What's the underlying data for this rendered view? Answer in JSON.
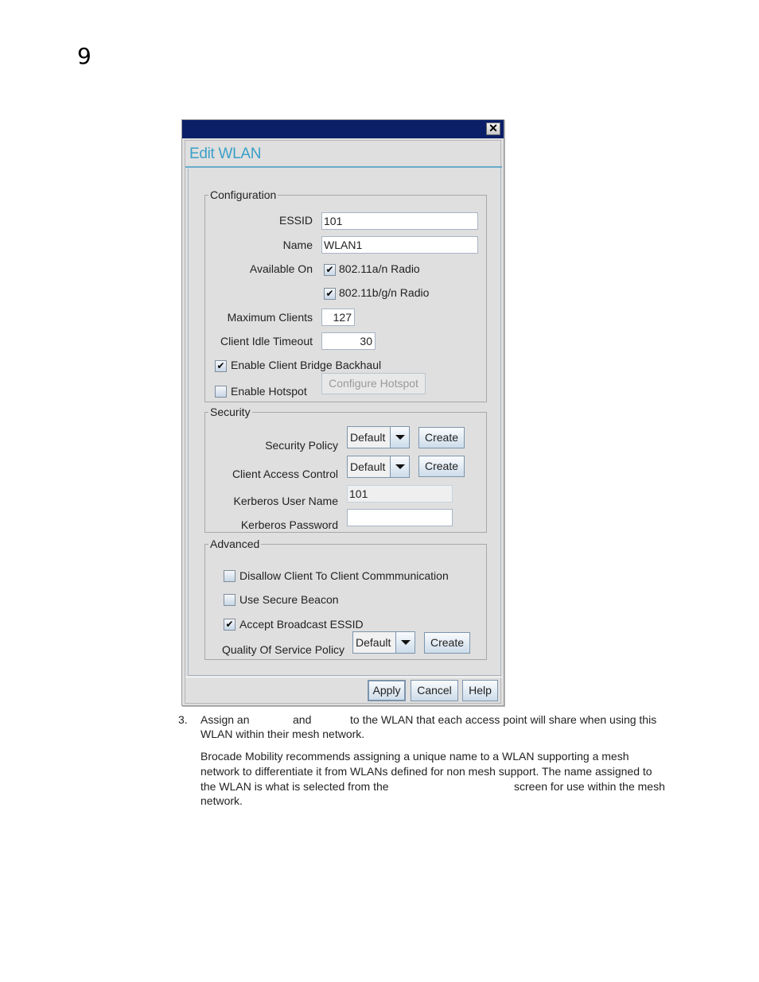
{
  "page": {
    "chapter_number": "9"
  },
  "window": {
    "close_glyph": "✕",
    "dialog_title": "Edit WLAN",
    "configuration": {
      "legend": "Configuration",
      "essid_label": "ESSID",
      "essid_value": "101",
      "name_label": "Name",
      "name_value": "WLAN1",
      "available_on_label": "Available On",
      "radio_an_label": "802.11a/n Radio",
      "radio_an_checked": true,
      "radio_bgn_label": "802.11b/g/n Radio",
      "radio_bgn_checked": true,
      "max_clients_label": "Maximum Clients",
      "max_clients_value": "127",
      "idle_timeout_label": "Client Idle Timeout",
      "idle_timeout_value": "30",
      "bridge_backhaul_label": "Enable Client Bridge Backhaul",
      "bridge_backhaul_checked": true,
      "hotspot_label": "Enable Hotspot",
      "hotspot_checked": false,
      "configure_hotspot_label": "Configure Hotspot"
    },
    "security": {
      "legend": "Security",
      "security_policy_label": "Security Policy",
      "security_policy_value": "Default",
      "client_access_label": "Client Access Control",
      "client_access_value": "Default",
      "create_label": "Create",
      "kerberos_user_label": "Kerberos User Name",
      "kerberos_user_value": "101",
      "kerberos_password_label": "Kerberos Password",
      "kerberos_password_value": ""
    },
    "advanced": {
      "legend": "Advanced",
      "disallow_label": "Disallow Client To Client Commmunication",
      "disallow_checked": false,
      "secure_beacon_label": "Use Secure Beacon",
      "secure_beacon_checked": false,
      "accept_broadcast_label": "Accept Broadcast ESSID",
      "accept_broadcast_checked": true,
      "qos_label": "Quality Of Service Policy",
      "qos_value": "Default",
      "create_label": "Create"
    },
    "footer": {
      "apply": "Apply",
      "cancel": "Cancel",
      "help": "Help"
    },
    "check_glyph": "✔"
  },
  "doc": {
    "step_number": "3.",
    "step_part1": "Assign an",
    "step_part2": "and",
    "step_part3": "to the WLAN that each access point will share when using this",
    "step_line2": "WLAN within their mesh network.",
    "para_line1": "Brocade Mobility recommends assigning a unique name to a WLAN supporting a mesh",
    "para_line2": "network to differentiate it from WLANs defined for non mesh support. The name assigned to",
    "para_line3a": "the WLAN is what is selected from the",
    "para_line3b": "screen for use within the mesh",
    "para_line4": "network."
  }
}
